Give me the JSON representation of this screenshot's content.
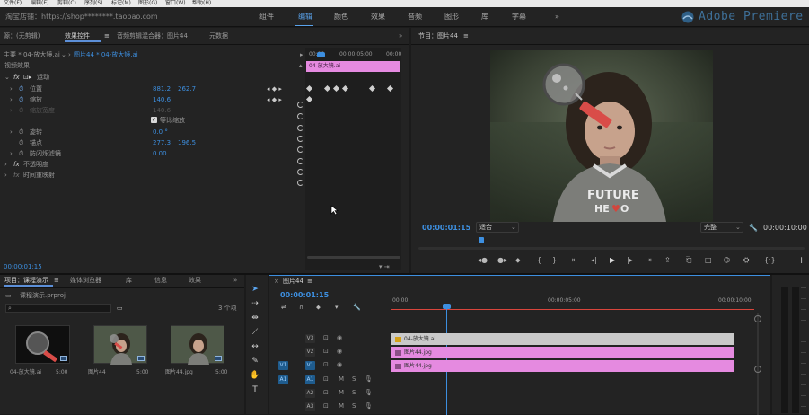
{
  "menu": {
    "items": [
      "文件(F)",
      "编辑(E)",
      "剪辑(C)",
      "序列(S)",
      "标记(M)",
      "图形(G)",
      "窗口(W)",
      "帮助(H)"
    ]
  },
  "topbar": {
    "shop": "淘宝店铺：https://shop********.taobao.com",
    "workspaces": [
      "组件",
      "编辑",
      "颜色",
      "效果",
      "音频",
      "图形",
      "库",
      "字幕"
    ],
    "more": "»",
    "brand": "Adobe Premiere"
  },
  "effects_panel": {
    "tabs": [
      "源：(无剪辑)",
      "效果控件",
      "音频剪辑混合器：图片44",
      "元数据"
    ],
    "master": "主要 * 04-放大镜.ai",
    "sequence": "图片44 * 04-放大镜.ai",
    "clip_label": "04-放大镜.ai",
    "section_video": "视频效果",
    "motion": "运动",
    "position": {
      "label": "位置",
      "x": "881.2",
      "y": "262.7"
    },
    "scale": {
      "label": "缩放",
      "value": "140.6"
    },
    "scale_width": {
      "label": "缩放宽度",
      "value": "140.6"
    },
    "uniform": "等比缩放",
    "rotation": {
      "label": "旋转",
      "value": "0.0 °"
    },
    "anchor": {
      "label": "锚点",
      "x": "277.3",
      "y": "196.5"
    },
    "antiflicker": {
      "label": "防闪烁滤镜",
      "value": "0.00"
    },
    "opacity": "不透明度",
    "time_remap": "时间重映射",
    "ruler": [
      "00:00",
      "00:00:05:00",
      "00:00"
    ],
    "timecode": "00:00:01:15"
  },
  "program": {
    "title": "节目：图片44",
    "timecode": "00:00:01:15",
    "fit": "适合",
    "quality": "完整",
    "duration": "00:00:10:00"
  },
  "project": {
    "tabs": [
      "项目：课程演示",
      "媒体浏览器",
      "库",
      "信息",
      "效果"
    ],
    "file": "课程演示.prproj",
    "count": "3 个项",
    "items": [
      {
        "name": "04-放大镜.ai",
        "duration": "5:00"
      },
      {
        "name": "图片44",
        "duration": "5:00"
      },
      {
        "name": "图片44.jpg",
        "duration": "5:00"
      }
    ]
  },
  "timeline": {
    "title": "图片44",
    "timecode": "00:00:01:15",
    "ruler": [
      "00:00",
      "00:00:05:00",
      "00:00:10:00"
    ],
    "video_tracks": [
      {
        "name": "V3",
        "clip": "04-放大镜.ai"
      },
      {
        "name": "V2",
        "clip": "图片44.jpg"
      },
      {
        "name": "V1",
        "clip": "图片44.jpg"
      }
    ],
    "audio_tracks": [
      "A1",
      "A2",
      "A3"
    ],
    "toggle_m": "M",
    "toggle_s": "S"
  },
  "colors": {
    "accent": "#3d8fe0",
    "clip_pink": "#e58ae0",
    "clip_gray": "#c9c9c9",
    "playhead": "#3d8fe0"
  }
}
